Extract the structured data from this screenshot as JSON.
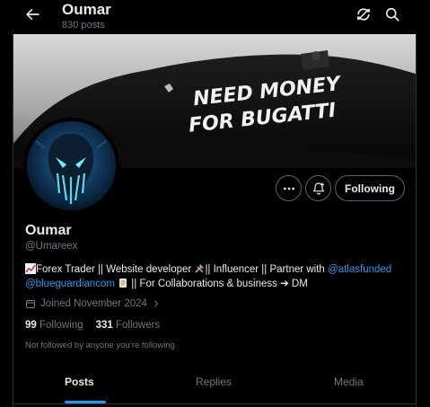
{
  "header": {
    "title": "Oumar",
    "post_count": "830 posts"
  },
  "banner": {
    "text_line1": "NEED MONEY",
    "text_line2": "FOR BUGATTI"
  },
  "profile": {
    "following_label": "Following",
    "name": "Oumar",
    "handle": "@Umareex",
    "bio": {
      "part1": "Forex Trader || Website developer ",
      "part2": "|| Influencer || Partner with ",
      "mention1": "@atlasfunded",
      "mention2": "@blueguardiancom",
      "part3": " || For Collaborations & business ➔ DM"
    },
    "joined": "Joined November 2024",
    "following_count": "99",
    "following_text": "Following",
    "followers_count": "331",
    "followers_text": "Followers",
    "not_followed": "Not followed by anyone you’re following"
  },
  "tabs": [
    {
      "label": "Posts"
    },
    {
      "label": "Replies"
    },
    {
      "label": "Media"
    }
  ],
  "colors": {
    "accent": "#1d9bf0",
    "background": "#000000",
    "muted": "#71767b"
  }
}
